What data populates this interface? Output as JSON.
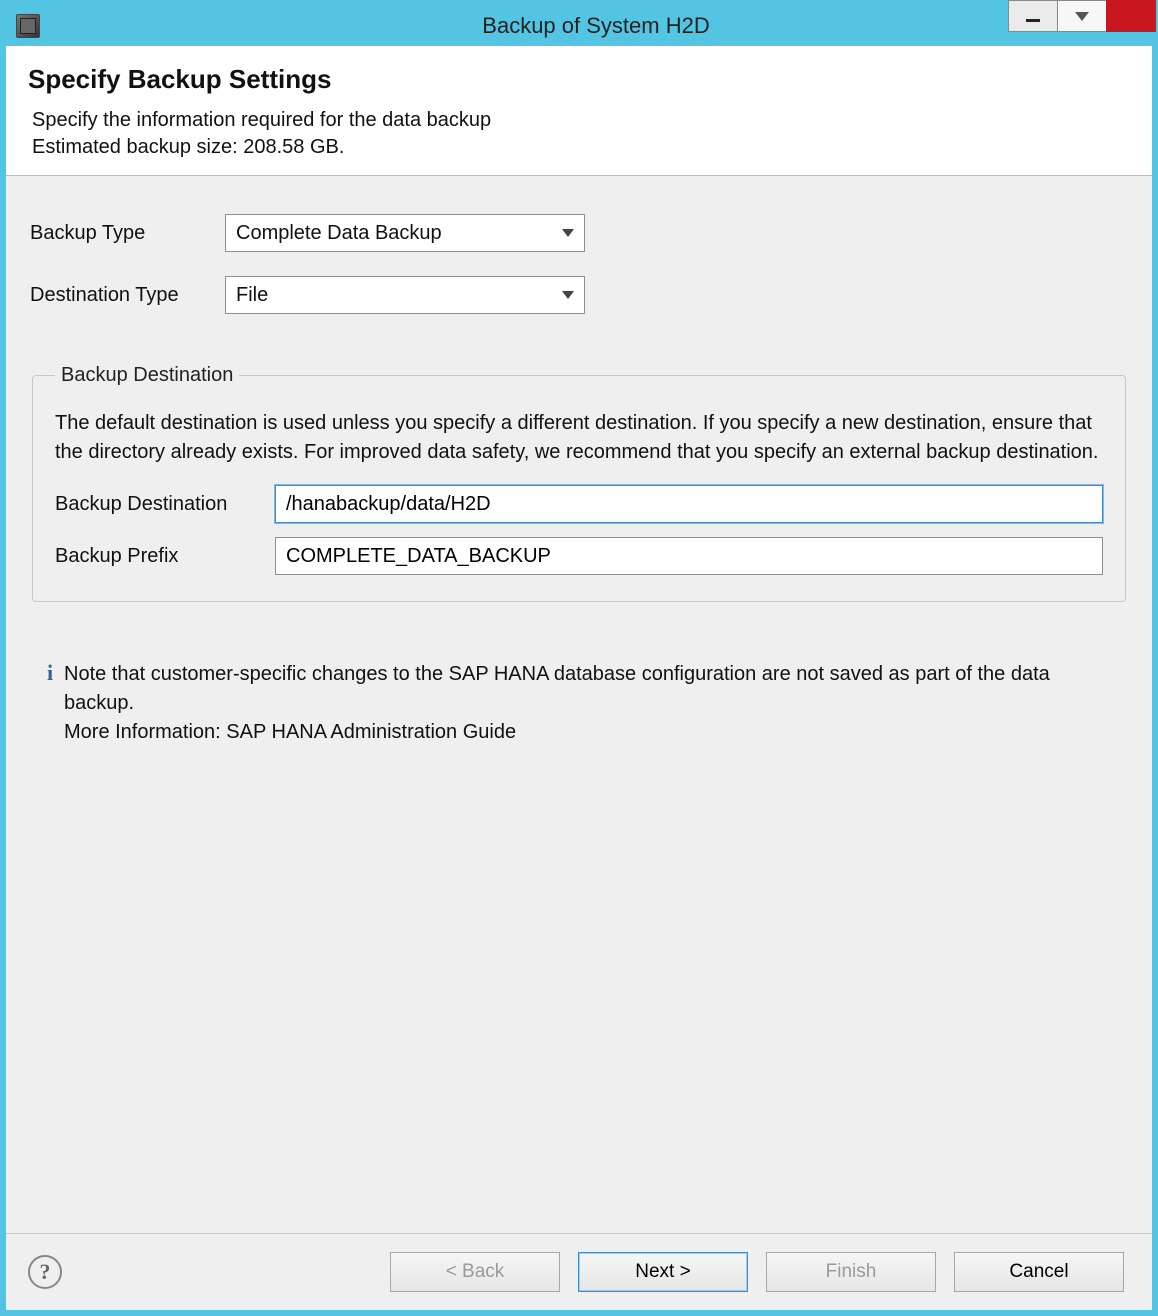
{
  "window": {
    "title": "Backup of System H2D"
  },
  "caption": {
    "minimize_tooltip": "Minimize",
    "menu_tooltip": "Window menu",
    "close_tooltip": "Close"
  },
  "header": {
    "title": "Specify Backup Settings",
    "subtitle_line1": "Specify the information required for the data backup",
    "subtitle_line2": "Estimated backup size: 208.58 GB."
  },
  "form": {
    "backup_type_label": "Backup Type",
    "backup_type_value": "Complete Data Backup",
    "destination_type_label": "Destination Type",
    "destination_type_value": "File"
  },
  "destination_group": {
    "legend": "Backup Destination",
    "description": "The default destination is used unless you specify a different destination. If you specify a new destination, ensure that the directory already exists. For improved data safety, we recommend that you specify an external backup destination.",
    "dest_label": "Backup Destination",
    "dest_value": "/hanabackup/data/H2D",
    "prefix_label": "Backup Prefix",
    "prefix_value": "COMPLETE_DATA_BACKUP"
  },
  "info": {
    "line1": "Note that customer-specific changes to the SAP HANA database configuration are not saved as part of the data backup.",
    "line2": "More Information: SAP HANA Administration Guide"
  },
  "footer": {
    "help_glyph": "?",
    "back_label": "< Back",
    "next_label": "Next >",
    "finish_label": "Finish",
    "cancel_label": "Cancel"
  }
}
